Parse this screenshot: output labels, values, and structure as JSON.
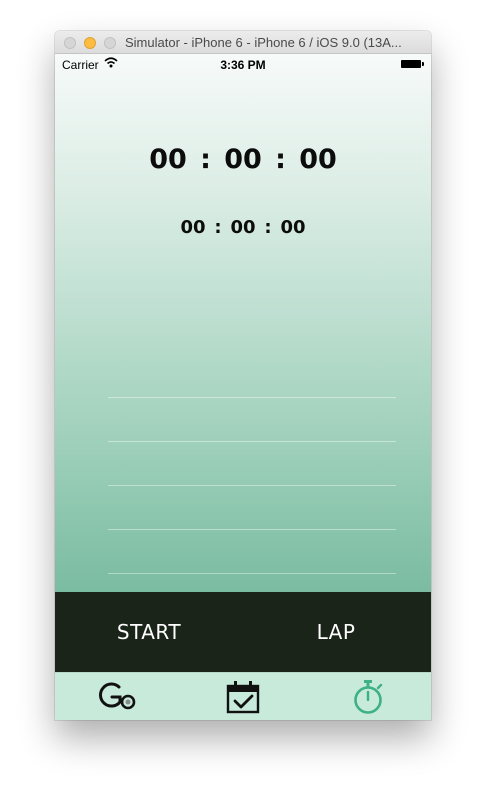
{
  "window": {
    "title": "Simulator - iPhone 6 - iPhone 6 / iOS 9.0 (13A..."
  },
  "status_bar": {
    "carrier": "Carrier",
    "time": "3:36 PM"
  },
  "stopwatch": {
    "main": {
      "hours": "00",
      "minutes": "00",
      "seconds": "00",
      "separator": ":"
    },
    "lap": {
      "hours": "00",
      "minutes": "00",
      "seconds": "00",
      "separator": ":"
    }
  },
  "controls": {
    "start_label": "START",
    "lap_label": "LAP"
  },
  "tabs": [
    {
      "icon": "go-icon",
      "selected": false
    },
    {
      "icon": "calendar-check-icon",
      "selected": false
    },
    {
      "icon": "stopwatch-icon",
      "selected": true
    }
  ],
  "colors": {
    "gradient_top": "#f7faf9",
    "gradient_bottom": "#5bab8c",
    "control_bar": "#1b2419",
    "tab_bar": "#c7eadb",
    "tab_selected": "#3db183",
    "tab_default": "#111111"
  }
}
